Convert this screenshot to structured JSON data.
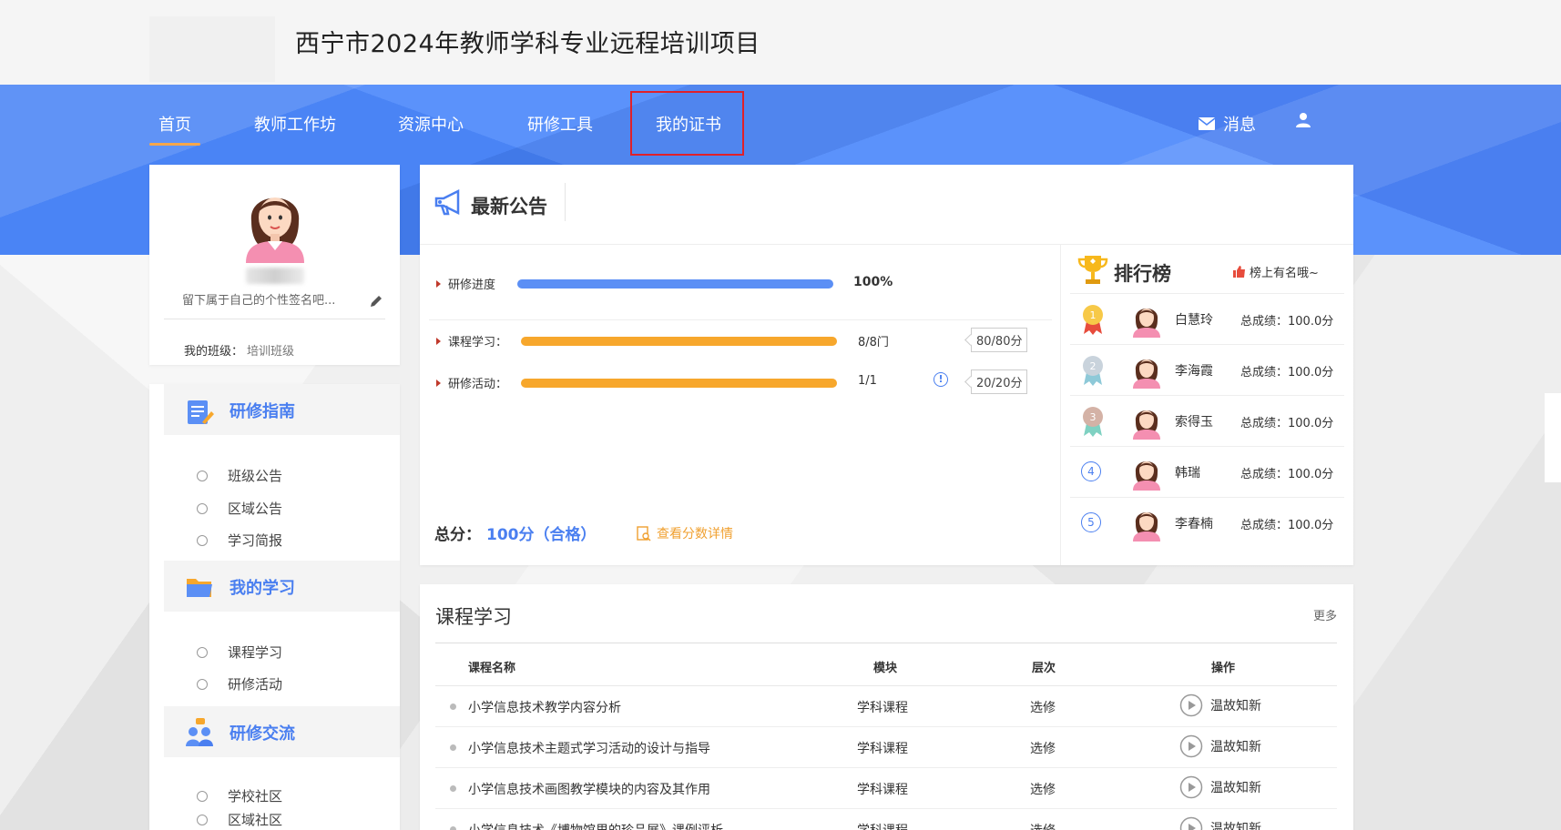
{
  "header": {
    "site_title": "西宁市2024年教师学科专业远程培训项目"
  },
  "nav": {
    "items": [
      {
        "label": "首页",
        "active": true
      },
      {
        "label": "教师工作坊"
      },
      {
        "label": "资源中心"
      },
      {
        "label": "研修工具"
      },
      {
        "label": "我的证书"
      }
    ],
    "messages_label": "消息"
  },
  "profile": {
    "signature_placeholder": "留下属于自己的个性签名吧...",
    "class_label": "我的班级：",
    "class_value": "培训班级"
  },
  "menu": {
    "sections": [
      {
        "title": "研修指南",
        "items": [
          "班级公告",
          "区域公告",
          "学习简报"
        ]
      },
      {
        "title": "我的学习",
        "items": [
          "课程学习",
          "研修活动"
        ]
      },
      {
        "title": "研修交流",
        "items": [
          "学校社区",
          "区域社区"
        ]
      }
    ]
  },
  "announcement": {
    "title": "最新公告"
  },
  "progress": {
    "overall": {
      "label": "研修进度",
      "value": "100%",
      "fraction": 1.0
    },
    "rows": [
      {
        "label": "课程学习：",
        "count": "8/8门",
        "score": "80/80分",
        "fraction": 1.0
      },
      {
        "label": "研修活动：",
        "count": "1/1",
        "score": "20/20分",
        "fraction": 1.0
      }
    ],
    "total_label": "总分：",
    "total_value": "100分（合格）",
    "detail_link": "查看分数详情"
  },
  "ranking": {
    "title": "排行榜",
    "subtitle": "榜上有名哦~",
    "rows": [
      {
        "rank": "1",
        "name": "白慧玲",
        "score": "总成绩：100.0分"
      },
      {
        "rank": "2",
        "name": "李海霞",
        "score": "总成绩：100.0分"
      },
      {
        "rank": "3",
        "name": "索得玉",
        "score": "总成绩：100.0分"
      },
      {
        "rank": "4",
        "name": "韩瑞",
        "score": "总成绩：100.0分"
      },
      {
        "rank": "5",
        "name": "李春楠",
        "score": "总成绩：100.0分"
      }
    ]
  },
  "course": {
    "title": "课程学习",
    "more": "更多",
    "headers": [
      "课程名称",
      "模块",
      "层次",
      "操作"
    ],
    "rows": [
      {
        "name": "小学信息技术教学内容分析",
        "module": "学科课程",
        "level": "选修",
        "action": "温故知新"
      },
      {
        "name": "小学信息技术主题式学习活动的设计与指导",
        "module": "学科课程",
        "level": "选修",
        "action": "温故知新"
      },
      {
        "name": "小学信息技术画图教学模块的内容及其作用",
        "module": "学科课程",
        "level": "选修",
        "action": "温故知新"
      },
      {
        "name": "小学信息技术《博物馆里的珍品展》课例评析",
        "module": "学科课程",
        "level": "选修",
        "action": "温故知新"
      }
    ]
  },
  "colors": {
    "primary": "#4a7ff0",
    "accent": "#f6a64a",
    "progress_blue": "#5b8ff5",
    "progress_orange": "#f7a72c",
    "highlight_red": "#e0202a"
  }
}
